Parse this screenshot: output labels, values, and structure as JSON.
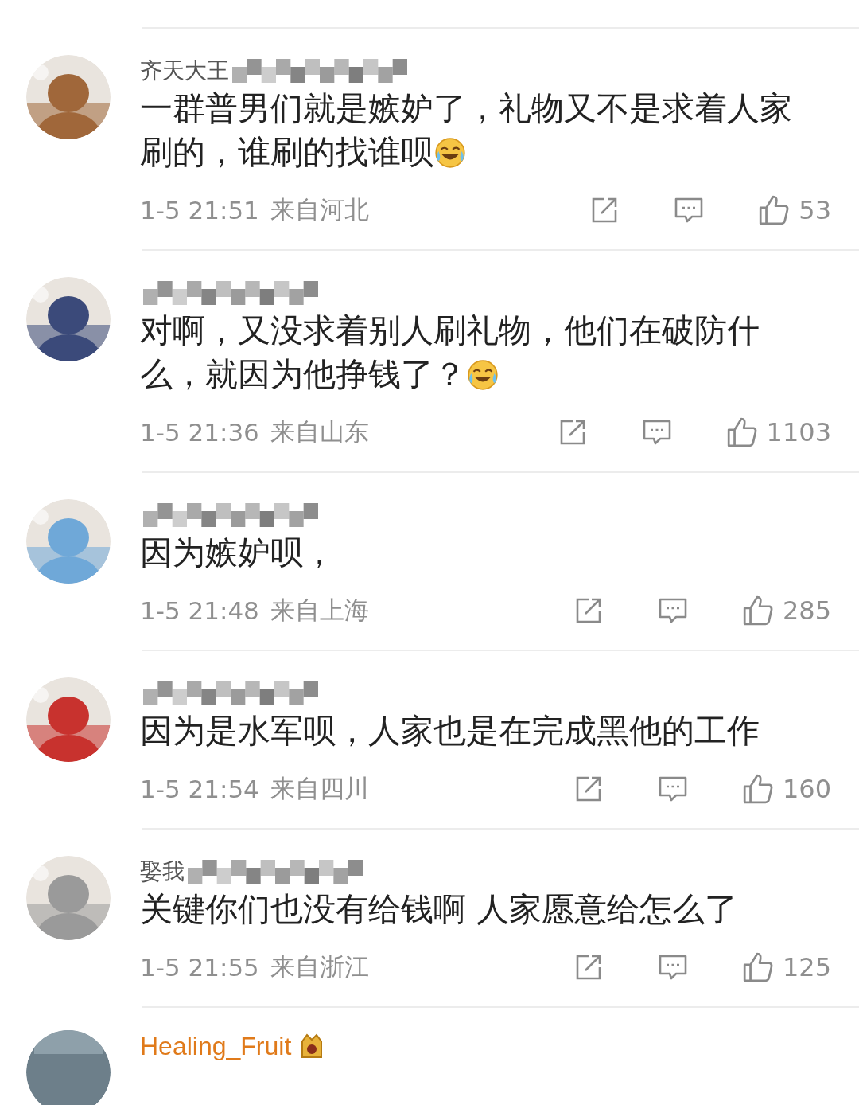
{
  "comments": [
    {
      "name": "齐天大王",
      "name_redacted": true,
      "text": "一群普男们就是嫉妒了，礼物又不是求着人家刷的，谁刷的找谁呗",
      "trailing_emoji": true,
      "time": "1-5 21:51",
      "location": "来自河北",
      "likes": "53"
    },
    {
      "name_redacted": true,
      "text": "对啊，又没求着别人刷礼物，他们在破防什么，就因为他挣钱了？",
      "trailing_emoji": true,
      "time": "1-5 21:36",
      "location": "来自山东",
      "likes": "1103"
    },
    {
      "name_redacted": true,
      "text": "因为嫉妒呗，",
      "trailing_emoji": false,
      "time": "1-5 21:48",
      "location": "来自上海",
      "likes": "285"
    },
    {
      "name_redacted": true,
      "text": "因为是水军呗，人家也是在完成黑他的工作",
      "trailing_emoji": false,
      "time": "1-5 21:54",
      "location": "来自四川",
      "likes": "160"
    },
    {
      "name": "娶我",
      "name_redacted": true,
      "text": "关键你们也没有给钱啊 人家愿意给怎么了",
      "trailing_emoji": false,
      "time": "1-5 21:55",
      "location": "来自浙江",
      "likes": "125"
    }
  ],
  "next_comment": {
    "name": "Healing_Fruit"
  }
}
